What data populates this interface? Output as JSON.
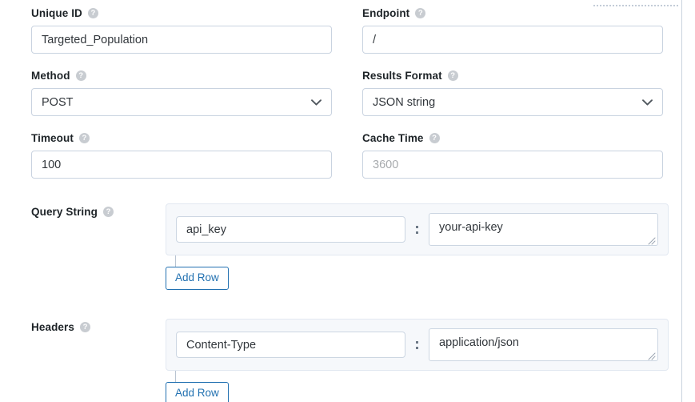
{
  "fields": [
    {
      "label": "Unique ID",
      "help_icon": "help-circle-icon",
      "help_glyph": "?",
      "type": "text",
      "value": "Targeted_Population",
      "placeholder": "",
      "name": "unique-id"
    },
    {
      "label": "Endpoint",
      "help_icon": "help-circle-icon",
      "help_glyph": "?",
      "type": "text",
      "value": "/",
      "placeholder": "",
      "name": "endpoint"
    },
    {
      "label": "Method",
      "help_icon": "help-circle-icon",
      "help_glyph": "?",
      "type": "select",
      "value": "POST",
      "placeholder": "",
      "name": "method"
    },
    {
      "label": "Results Format",
      "help_icon": "help-circle-icon",
      "help_glyph": "?",
      "type": "select",
      "value": "JSON string",
      "placeholder": "",
      "name": "results-format"
    },
    {
      "label": "Timeout",
      "help_icon": "help-circle-icon",
      "help_glyph": "?",
      "type": "text",
      "value": "100",
      "placeholder": "",
      "name": "timeout"
    },
    {
      "label": "Cache Time",
      "help_icon": "help-circle-icon",
      "help_glyph": "?",
      "type": "text",
      "value": "",
      "placeholder": "3600",
      "name": "cache-time"
    }
  ],
  "query_string": {
    "label": "Query String",
    "help_glyph": "?",
    "separator": "colon-separator-icon",
    "rows": [
      {
        "key": "api_key",
        "value": "your-api-key"
      }
    ],
    "add_row_label": "Add Row"
  },
  "headers": {
    "label": "Headers",
    "help_glyph": "?",
    "separator": "colon-separator-icon",
    "rows": [
      {
        "key": "Content-Type",
        "value": "application/json"
      }
    ],
    "add_row_label": "Add Row"
  },
  "colors": {
    "accent": "#2271b1",
    "label_text": "#1d2327",
    "field_text": "#32373c",
    "placeholder_text": "#a7aaad",
    "field_border": "#c9d3e0",
    "panel_bg": "#f6f8fb",
    "panel_border": "#e2e8f1",
    "help_icon_bg": "#c8ccd1"
  }
}
